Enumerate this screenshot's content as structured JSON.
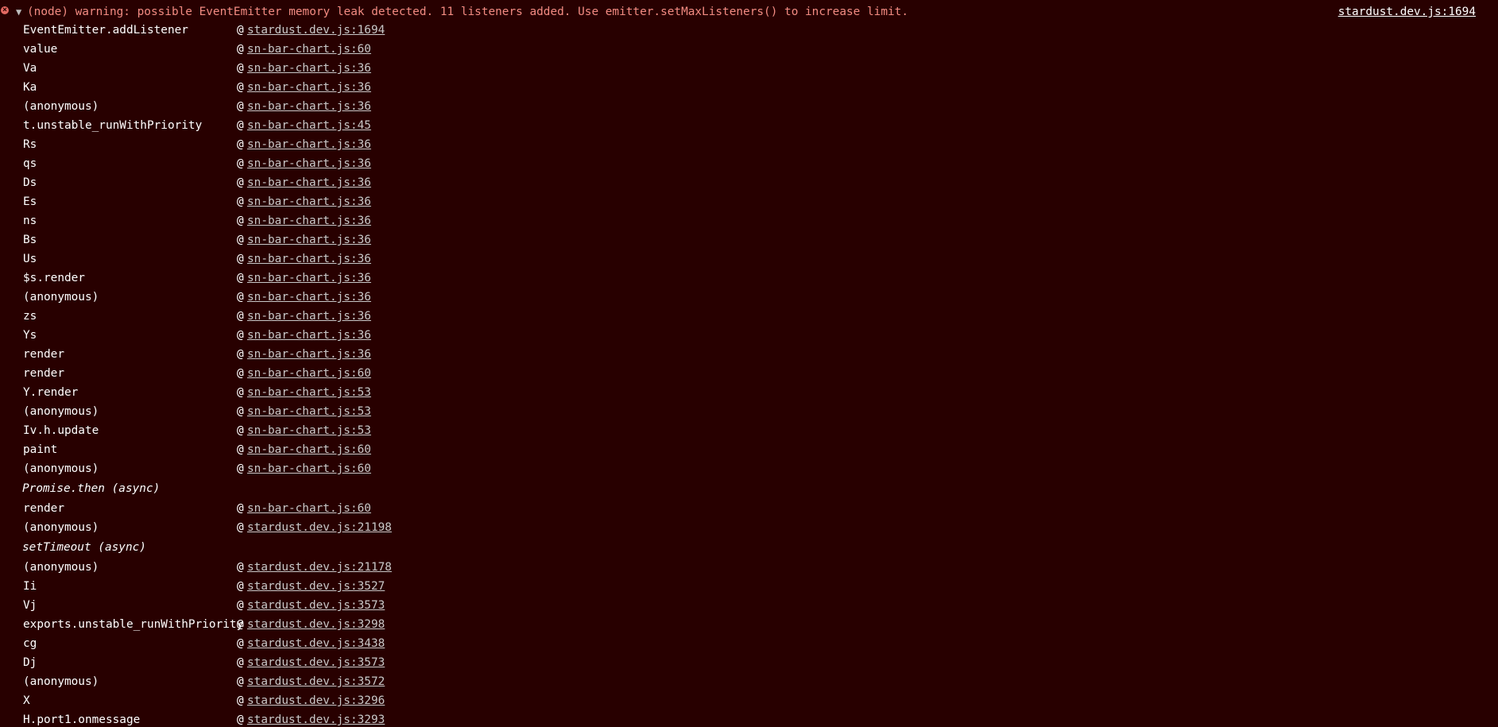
{
  "header": {
    "expand_glyph": "▼",
    "error_glyph": "×",
    "message": "(node) warning: possible EventEmitter memory leak detected. 11 listeners added. Use emitter.setMaxListeners() to increase limit.",
    "source": "stardust.dev.js:1694"
  },
  "frames": [
    {
      "fn": "EventEmitter.addListener",
      "at": "@",
      "loc": "stardust.dev.js:1694"
    },
    {
      "fn": "value",
      "at": "@",
      "loc": "sn-bar-chart.js:60"
    },
    {
      "fn": "Va",
      "at": "@",
      "loc": "sn-bar-chart.js:36"
    },
    {
      "fn": "Ka",
      "at": "@",
      "loc": "sn-bar-chart.js:36"
    },
    {
      "fn": "(anonymous)",
      "at": "@",
      "loc": "sn-bar-chart.js:36"
    },
    {
      "fn": "t.unstable_runWithPriority",
      "at": "@",
      "loc": "sn-bar-chart.js:45"
    },
    {
      "fn": "Rs",
      "at": "@",
      "loc": "sn-bar-chart.js:36"
    },
    {
      "fn": "qs",
      "at": "@",
      "loc": "sn-bar-chart.js:36"
    },
    {
      "fn": "Ds",
      "at": "@",
      "loc": "sn-bar-chart.js:36"
    },
    {
      "fn": "Es",
      "at": "@",
      "loc": "sn-bar-chart.js:36"
    },
    {
      "fn": "ns",
      "at": "@",
      "loc": "sn-bar-chart.js:36"
    },
    {
      "fn": "Bs",
      "at": "@",
      "loc": "sn-bar-chart.js:36"
    },
    {
      "fn": "Us",
      "at": "@",
      "loc": "sn-bar-chart.js:36"
    },
    {
      "fn": "$s.render",
      "at": "@",
      "loc": "sn-bar-chart.js:36"
    },
    {
      "fn": "(anonymous)",
      "at": "@",
      "loc": "sn-bar-chart.js:36"
    },
    {
      "fn": "zs",
      "at": "@",
      "loc": "sn-bar-chart.js:36"
    },
    {
      "fn": "Ys",
      "at": "@",
      "loc": "sn-bar-chart.js:36"
    },
    {
      "fn": "render",
      "at": "@",
      "loc": "sn-bar-chart.js:36"
    },
    {
      "fn": "render",
      "at": "@",
      "loc": "sn-bar-chart.js:60"
    },
    {
      "fn": "Y.render",
      "at": "@",
      "loc": "sn-bar-chart.js:53"
    },
    {
      "fn": "(anonymous)",
      "at": "@",
      "loc": "sn-bar-chart.js:53"
    },
    {
      "fn": "Iv.h.update",
      "at": "@",
      "loc": "sn-bar-chart.js:53"
    },
    {
      "fn": "paint",
      "at": "@",
      "loc": "sn-bar-chart.js:60"
    },
    {
      "fn": "(anonymous)",
      "at": "@",
      "loc": "sn-bar-chart.js:60"
    },
    {
      "async": true,
      "fn": "Promise.then (async)"
    },
    {
      "fn": "render",
      "at": "@",
      "loc": "sn-bar-chart.js:60"
    },
    {
      "fn": "(anonymous)",
      "at": "@",
      "loc": "stardust.dev.js:21198"
    },
    {
      "async": true,
      "fn": "setTimeout (async)"
    },
    {
      "fn": "(anonymous)",
      "at": "@",
      "loc": "stardust.dev.js:21178"
    },
    {
      "fn": "Ii",
      "at": "@",
      "loc": "stardust.dev.js:3527"
    },
    {
      "fn": "Vj",
      "at": "@",
      "loc": "stardust.dev.js:3573"
    },
    {
      "fn": "exports.unstable_runWithPriority",
      "at": "@",
      "loc": "stardust.dev.js:3298"
    },
    {
      "fn": "cg",
      "at": "@",
      "loc": "stardust.dev.js:3438"
    },
    {
      "fn": "Dj",
      "at": "@",
      "loc": "stardust.dev.js:3573"
    },
    {
      "fn": "(anonymous)",
      "at": "@",
      "loc": "stardust.dev.js:3572"
    },
    {
      "fn": "X",
      "at": "@",
      "loc": "stardust.dev.js:3296"
    },
    {
      "fn": "H.port1.onmessage",
      "at": "@",
      "loc": "stardust.dev.js:3293"
    }
  ],
  "colors": {
    "background": "#280000",
    "error_text": "#f28b82",
    "error_icon": "#e46962"
  }
}
